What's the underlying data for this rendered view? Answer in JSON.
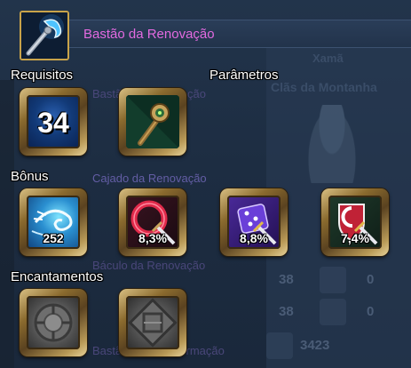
{
  "background": {
    "texts": [
      "Xamã",
      "Clãs da Montanha",
      "Bastão da Renovação",
      "Cajado da Renovação",
      "Báculo da Renovação",
      "Bastão da Transformação"
    ],
    "stats": [
      "38",
      "0",
      "38",
      "0",
      "3423"
    ]
  },
  "item": {
    "name": "Bastão da Renovação",
    "name_color": "#e26ae0",
    "icon": "staff-icon"
  },
  "sections": {
    "requirements": "Requisitos",
    "parameters": "Parâmetros",
    "bonus": "Bônus",
    "enchantments": "Encantamentos"
  },
  "requirements": {
    "level": "34",
    "icon": "level-icon"
  },
  "parameters": {
    "icon": "totem-staff-icon"
  },
  "bonuses": [
    {
      "icon": "wind-swirl-icon",
      "value": "252"
    },
    {
      "icon": "red-ring-sword-icon",
      "value": "8,3%"
    },
    {
      "icon": "purple-dice-sword-icon",
      "value": "8,8%"
    },
    {
      "icon": "red-shield-sword-icon",
      "value": "7,4%"
    }
  ],
  "enchantments": [
    {
      "icon": "grey-circle-rune-icon"
    },
    {
      "icon": "grey-square-rune-icon"
    }
  ]
}
